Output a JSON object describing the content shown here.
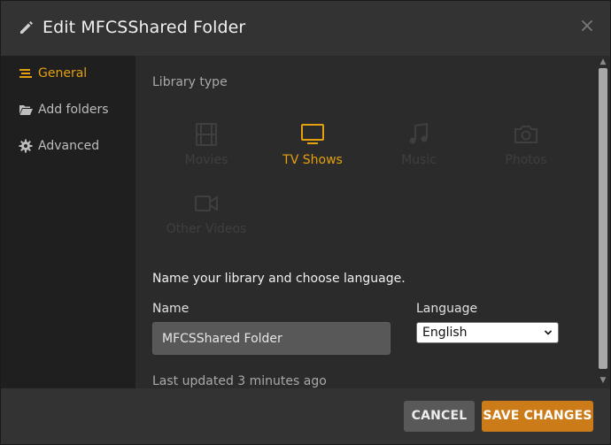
{
  "dialog": {
    "title": "Edit MFCSShared Folder"
  },
  "sidebar": {
    "items": [
      {
        "label": "General",
        "icon": "list-icon",
        "active": true
      },
      {
        "label": "Add folders",
        "icon": "folder-open-icon",
        "active": false
      },
      {
        "label": "Advanced",
        "icon": "gear-icon",
        "active": false
      }
    ]
  },
  "main": {
    "library_type_label": "Library type",
    "library_types": [
      {
        "label": "Movies",
        "icon": "film-icon",
        "selected": false
      },
      {
        "label": "TV Shows",
        "icon": "tv-icon",
        "selected": true
      },
      {
        "label": "Music",
        "icon": "music-note-icon",
        "selected": false
      },
      {
        "label": "Photos",
        "icon": "camera-icon",
        "selected": false
      },
      {
        "label": "Other Videos",
        "icon": "video-camera-icon",
        "selected": false
      }
    ],
    "prompt": "Name your library and choose language.",
    "name_label": "Name",
    "name_value": "MFCSShared Folder",
    "language_label": "Language",
    "language_value": "English",
    "last_updated": "Last updated 3 minutes ago"
  },
  "footer": {
    "cancel_label": "CANCEL",
    "save_label": "SAVE CHANGES"
  },
  "colors": {
    "accent": "#e5a00d",
    "save_button": "#cc7b19",
    "sidebar_bg": "#1f1f1f",
    "panel_bg": "#2b2b2b"
  }
}
